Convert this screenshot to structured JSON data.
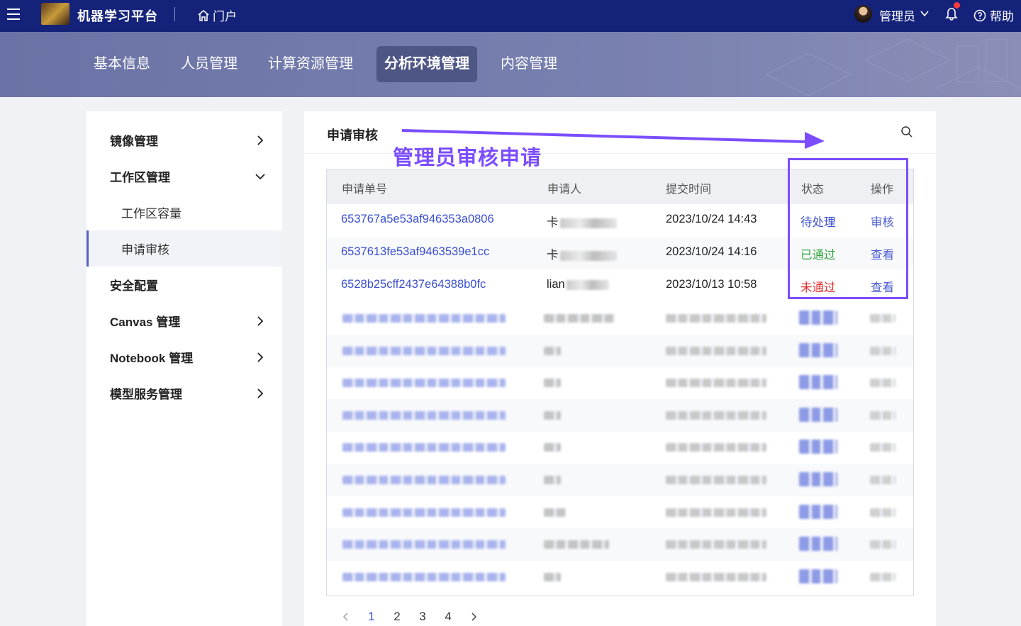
{
  "topbar": {
    "app_title": "机器学习平台",
    "portal_label": "门户",
    "user_label": "管理员",
    "help_label": "帮助"
  },
  "subnav": {
    "tabs": [
      {
        "label": "基本信息",
        "active": false
      },
      {
        "label": "人员管理",
        "active": false
      },
      {
        "label": "计算资源管理",
        "active": false
      },
      {
        "label": "分析环境管理",
        "active": true
      },
      {
        "label": "内容管理",
        "active": false
      }
    ]
  },
  "sidebar": {
    "items": [
      {
        "label": "镜像管理",
        "chevron": "right"
      },
      {
        "label": "工作区管理",
        "chevron": "down"
      },
      {
        "label": "工作区容量",
        "sub": true
      },
      {
        "label": "申请审核",
        "sub": true,
        "selected": true
      },
      {
        "label": "安全配置"
      },
      {
        "label": "Canvas 管理",
        "chevron": "right"
      },
      {
        "label": "Notebook 管理",
        "chevron": "right"
      },
      {
        "label": "模型服务管理",
        "chevron": "right"
      }
    ]
  },
  "panel": {
    "title": "申请审核",
    "annotation": "管理员审核申请",
    "annotation_color": "#7b4dff"
  },
  "table": {
    "headers": [
      "申请单号",
      "申请人",
      "提交时间",
      "状态",
      "操作"
    ],
    "rows": [
      {
        "id": "653767a5e53af946353a0806",
        "applicant": "卡",
        "time": "2023/10/24 14:43",
        "status": "待处理",
        "status_type": "pending",
        "action": "审核"
      },
      {
        "id": "6537613fe53af9463539e1cc",
        "applicant": "卡",
        "time": "2023/10/24 14:16",
        "status": "已通过",
        "status_type": "pass",
        "action": "查看"
      },
      {
        "id": "6528b25cff2437e64388b0fc",
        "applicant": "lian",
        "time": "2023/10/13 10:58",
        "status": "未通过",
        "status_type": "fail",
        "action": "查看"
      }
    ],
    "blurred_row_count": 9
  },
  "pagination": {
    "pages": [
      "1",
      "2",
      "3",
      "4"
    ],
    "current": "1"
  },
  "colors": {
    "topbar": "#14227a",
    "accent": "#3a4fd1",
    "pass": "#2fa33b",
    "fail": "#e02c2c"
  }
}
